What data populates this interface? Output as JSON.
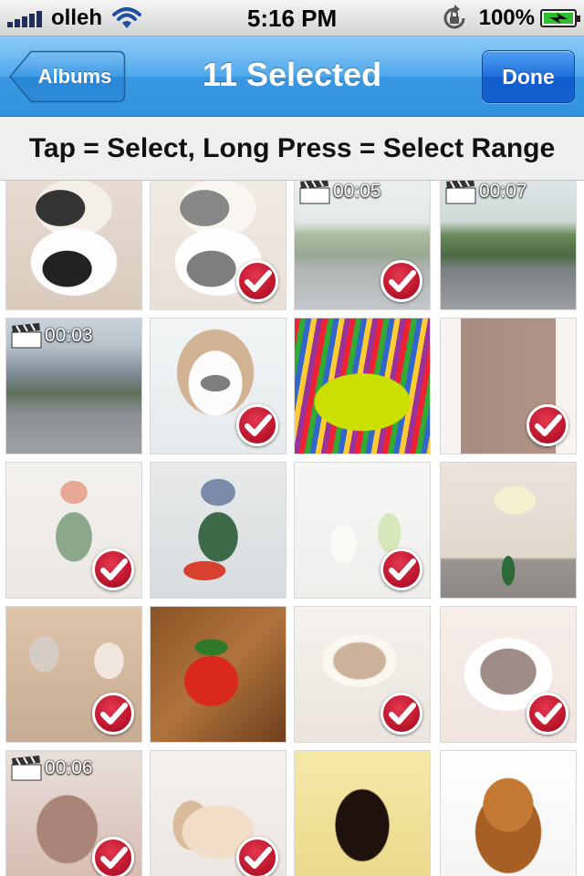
{
  "status_bar": {
    "carrier": "olleh",
    "time": "5:16 PM",
    "battery_percent": "100%",
    "icons": [
      "signal-bars-icon",
      "wifi-icon",
      "rotation-lock-icon",
      "battery-charging-icon"
    ]
  },
  "nav": {
    "back_label": "Albums",
    "title": "11 Selected",
    "done_label": "Done"
  },
  "hint": "Tap = Select, Long Press = Select Range",
  "colors": {
    "nav_blue": "#3a98e2",
    "done_blue": "#1661d0",
    "check_red": "#c0172f"
  },
  "photos": [
    {
      "id": "p1",
      "subject": "bulldog-puppies",
      "selected": false,
      "video": false,
      "duration": ""
    },
    {
      "id": "p2",
      "subject": "bulldog-puppies",
      "selected": true,
      "video": false,
      "duration": ""
    },
    {
      "id": "p3",
      "subject": "rainy-street-trees",
      "selected": true,
      "video": true,
      "duration": "00:05"
    },
    {
      "id": "p4",
      "subject": "rainy-street-trees",
      "selected": false,
      "video": true,
      "duration": "00:07"
    },
    {
      "id": "p5",
      "subject": "rainy-city-street",
      "selected": false,
      "video": true,
      "duration": "00:03"
    },
    {
      "id": "p6",
      "subject": "beagle-puppy",
      "selected": true,
      "video": false,
      "duration": ""
    },
    {
      "id": "p7",
      "subject": "colored-pencils-bucket",
      "selected": false,
      "video": false,
      "duration": ""
    },
    {
      "id": "p8",
      "subject": "iced-coffee-glass",
      "selected": true,
      "video": false,
      "duration": ""
    },
    {
      "id": "p9",
      "subject": "rabbit-drummer-toy",
      "selected": true,
      "video": false,
      "duration": ""
    },
    {
      "id": "p10",
      "subject": "elephant-drummer-toy",
      "selected": false,
      "video": false,
      "duration": ""
    },
    {
      "id": "p11",
      "subject": "bird-figurines",
      "selected": true,
      "video": false,
      "duration": ""
    },
    {
      "id": "p12",
      "subject": "daffodils-vase",
      "selected": false,
      "video": false,
      "duration": ""
    },
    {
      "id": "p13",
      "subject": "teddy-bears",
      "selected": true,
      "video": false,
      "duration": ""
    },
    {
      "id": "p14",
      "subject": "tomato",
      "selected": false,
      "video": false,
      "duration": ""
    },
    {
      "id": "p15",
      "subject": "coffee-cup",
      "selected": true,
      "video": false,
      "duration": ""
    },
    {
      "id": "p16",
      "subject": "chocolate-cake",
      "selected": true,
      "video": false,
      "duration": ""
    },
    {
      "id": "p17",
      "subject": "brown-dog",
      "selected": true,
      "video": true,
      "duration": "00:06"
    },
    {
      "id": "p18",
      "subject": "sleeping-puppy",
      "selected": true,
      "video": false,
      "duration": ""
    },
    {
      "id": "p19",
      "subject": "miniature-pinscher",
      "selected": false,
      "video": false,
      "duration": ""
    },
    {
      "id": "p20",
      "subject": "cocker-spaniel",
      "selected": false,
      "video": false,
      "duration": ""
    }
  ]
}
